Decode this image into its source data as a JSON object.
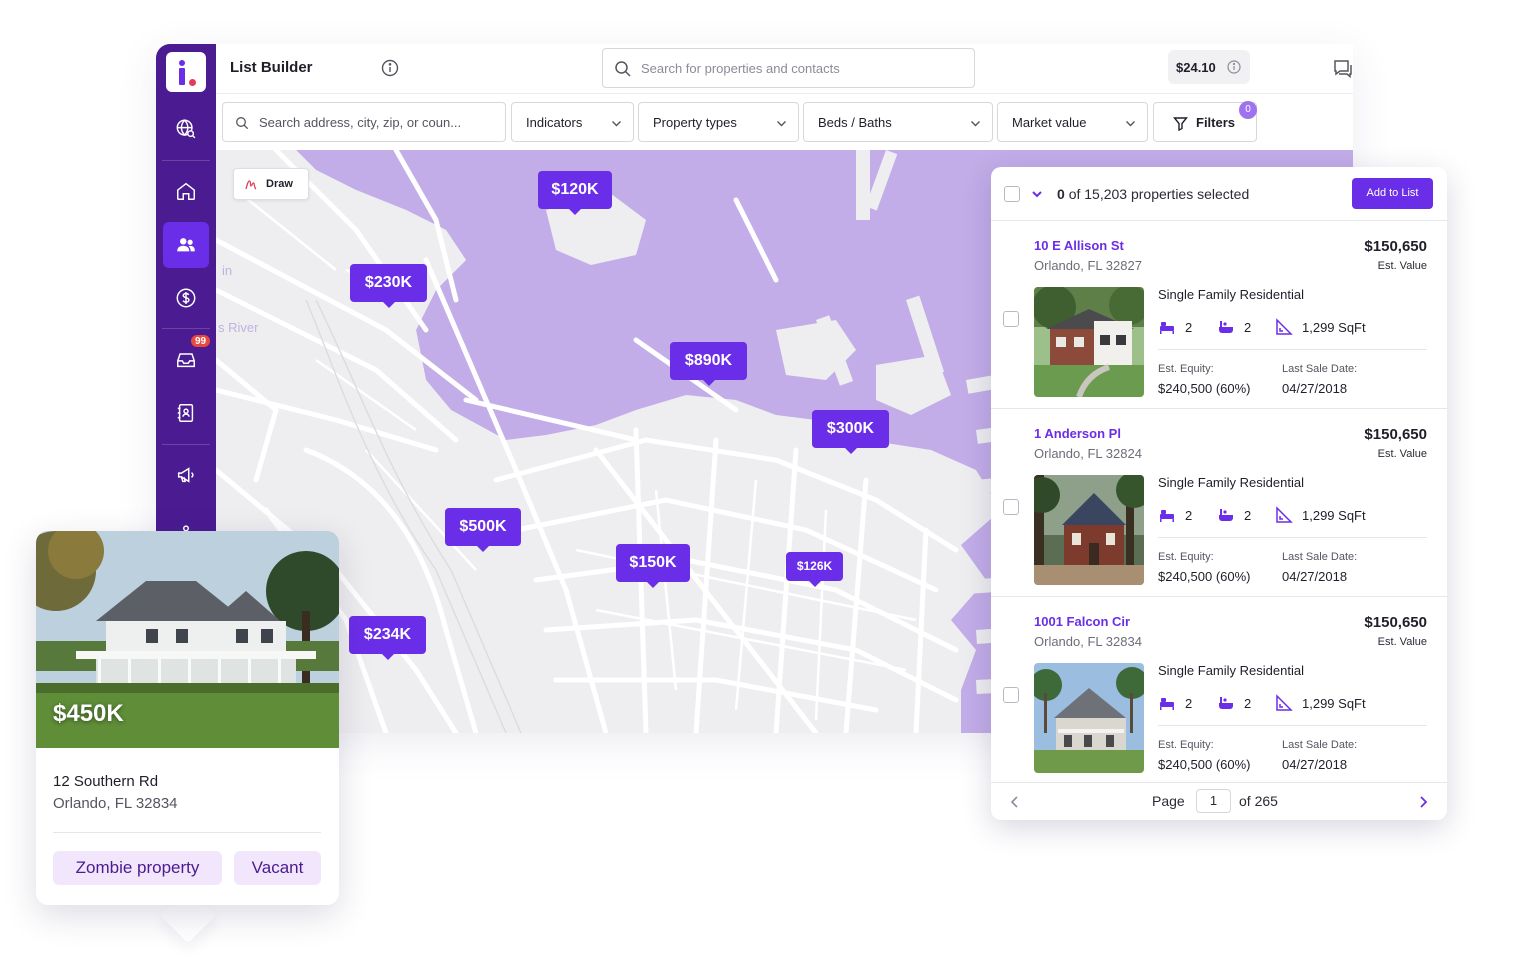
{
  "header": {
    "title": "List Builder",
    "search_placeholder": "Search for properties and contacts",
    "credit": "$24.10",
    "avatar_initial": "I"
  },
  "sidebar": {
    "items": [
      {
        "icon": "globe-search-icon"
      },
      {
        "icon": "home-icon"
      },
      {
        "icon": "users-icon",
        "active": true
      },
      {
        "icon": "dollar-icon"
      },
      {
        "icon": "inbox-icon",
        "badge": "99"
      },
      {
        "icon": "contacts-icon"
      },
      {
        "icon": "megaphone-icon"
      }
    ]
  },
  "filters": {
    "address_placeholder": "Search address, city, zip, or coun...",
    "indicators": "Indicators",
    "property_types": "Property types",
    "beds_baths": "Beds / Baths",
    "market_value": "Market value",
    "filters_label": "Filters",
    "filters_count": "0"
  },
  "map": {
    "draw_label": "Draw",
    "pins": [
      "$120K",
      "$230K",
      "$890K",
      "$300K",
      "$500K",
      "$150K",
      "$126K",
      "$234K"
    ]
  },
  "panel": {
    "selected_count": "0",
    "selected_text": "of 15,203 properties selected",
    "add_button": "Add to List",
    "properties": [
      {
        "address": "10 E Allison St",
        "city": "Orlando, FL 32827",
        "value": "$150,650",
        "value_label": "Est. Value",
        "type": "Single Family Residential",
        "beds": "2",
        "baths": "2",
        "sqft": "1,299 SqFt",
        "equity_label": "Est. Equity:",
        "equity": "$240,500 (60%)",
        "sale_label": "Last Sale Date:",
        "sale_date": "04/27/2018"
      },
      {
        "address": "1 Anderson Pl",
        "city": "Orlando, FL 32824",
        "value": "$150,650",
        "value_label": "Est. Value",
        "type": "Single Family Residential",
        "beds": "2",
        "baths": "2",
        "sqft": "1,299 SqFt",
        "equity_label": "Est. Equity:",
        "equity": "$240,500 (60%)",
        "sale_label": "Last Sale Date:",
        "sale_date": "04/27/2018"
      },
      {
        "address": "1001 Falcon Cir",
        "city": "Orlando, FL 32834",
        "value": "$150,650",
        "value_label": "Est. Value",
        "type": "Single Family Residential",
        "beds": "2",
        "baths": "2",
        "sqft": "1,299 SqFt",
        "equity_label": "Est. Equity:",
        "equity": "$240,500 (60%)",
        "sale_label": "Last Sale Date:",
        "sale_date": "04/27/2018"
      }
    ],
    "pager": {
      "page_label": "Page",
      "page": "1",
      "of_label": "of 265"
    }
  },
  "card": {
    "price": "$450K",
    "address": "12 Southern Rd",
    "city": "Orlando, FL 32834",
    "tags": [
      "Zombie property",
      "Vacant"
    ]
  },
  "colors": {
    "accent": "#6b2ee8",
    "sidebar": "#4a1b91",
    "water": "#c3ade8",
    "tag_bg": "#f1e6fb"
  }
}
